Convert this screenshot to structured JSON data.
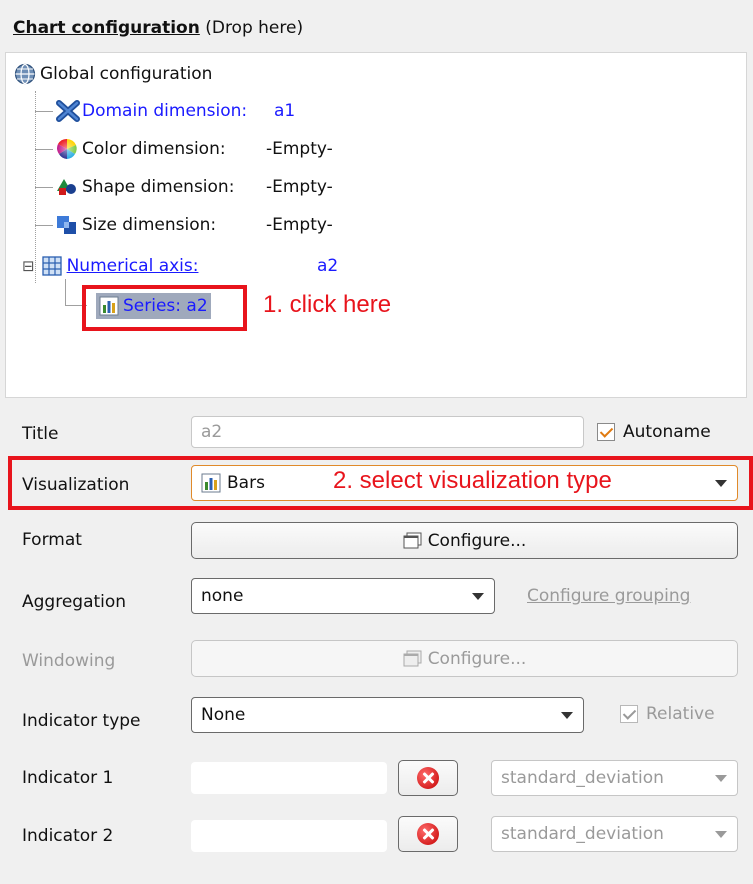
{
  "panel": {
    "title_bold": "Chart configuration",
    "title_rest": " (Drop here)"
  },
  "tree": {
    "root": {
      "label": "Global configuration",
      "icon": "globe-icon"
    },
    "items": [
      {
        "label": "Domain dimension:",
        "value": "a1",
        "icon": "cross-axes-icon",
        "link": true
      },
      {
        "label": "Color dimension:",
        "value": "-Empty-",
        "icon": "color-wheel-icon",
        "link": false
      },
      {
        "label": "Shape dimension:",
        "value": "-Empty-",
        "icon": "shapes-icon",
        "link": false
      },
      {
        "label": "Size dimension:",
        "value": "-Empty-",
        "icon": "size-icon",
        "link": false
      }
    ],
    "axis": {
      "label": "Numerical axis:",
      "value": "a2",
      "icon": "grid-axis-icon",
      "expander": "⊟"
    },
    "series": {
      "label": "Series: a2",
      "icon": "bar-chart-icon"
    }
  },
  "annotations": {
    "step1": "1. click here",
    "step2": "2. select visualization type"
  },
  "form": {
    "title": {
      "label": "Title",
      "value": "a2",
      "autoname_label": "Autoname",
      "autoname_checked": true
    },
    "visualization": {
      "label": "Visualization",
      "value": "Bars",
      "icon": "bar-chart-icon"
    },
    "format": {
      "label": "Format",
      "button": "Configure...",
      "icon": "window-icon"
    },
    "aggregation": {
      "label": "Aggregation",
      "value": "none",
      "link": "Configure grouping"
    },
    "windowing": {
      "label": "Windowing",
      "button": "Configure...",
      "icon": "window-icon"
    },
    "indicator_type": {
      "label": "Indicator type",
      "value": "None",
      "relative_label": "Relative",
      "relative_checked": true
    },
    "indicator1": {
      "label": "Indicator 1",
      "value": "",
      "select": "standard_deviation"
    },
    "indicator2": {
      "label": "Indicator 2",
      "value": "",
      "select": "standard_deviation"
    }
  },
  "colors": {
    "accent_red": "#e8141c",
    "link_blue": "#1a1aff",
    "selection": "#9fa9bc",
    "check_orange": "#e07a10"
  }
}
